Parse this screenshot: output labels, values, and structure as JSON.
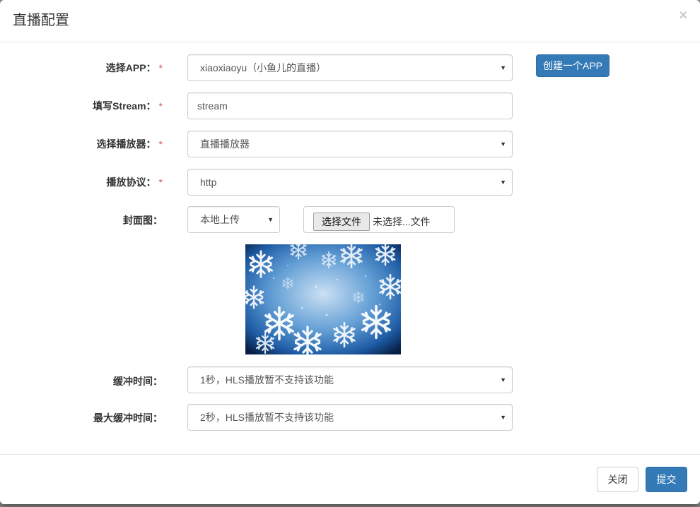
{
  "modal": {
    "title": "直播配置",
    "close_symbol": "×"
  },
  "form": {
    "required_mark": "*",
    "app": {
      "label": "选择APP：",
      "value": "xiaoxiaoyu（小鱼儿的直播）",
      "create_button": "创建一个APP"
    },
    "stream": {
      "label": "填写Stream：",
      "value": "stream"
    },
    "player": {
      "label": "选择播放器：",
      "value": "直播播放器"
    },
    "protocol": {
      "label": "播放协议：",
      "value": "http"
    },
    "cover": {
      "label": "封面图：",
      "source_value": "本地上传",
      "file_button": "选择文件",
      "file_status": "未选择...文件"
    },
    "buffer": {
      "label": "缓冲时间：",
      "value": "1秒，HLS播放暂不支持该功能"
    },
    "max_buffer": {
      "label": "最大缓冲时间：",
      "value": "2秒，HLS播放暂不支持该功能"
    }
  },
  "footer": {
    "close_button": "关闭",
    "submit_button": "提交"
  },
  "icons": {
    "select_caret": "▼"
  },
  "colors": {
    "primary": "#337ab7",
    "required": "#d9534f"
  }
}
